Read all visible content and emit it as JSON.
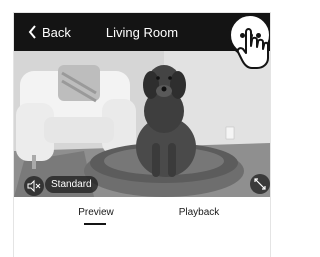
{
  "header": {
    "back_label": "Back",
    "title": "Living Room",
    "back_icon": "chevron-left-icon",
    "more_icon": "more-horizontal-icon"
  },
  "video": {
    "mute_icon": "speaker-muted-icon",
    "quality_label": "Standard",
    "fullscreen_icon": "fullscreen-icon"
  },
  "tabs": {
    "items": [
      {
        "label": "Preview",
        "selected": true
      },
      {
        "label": "Playback",
        "selected": false
      }
    ]
  },
  "colors": {
    "header_bg": "#141414",
    "accent": "#141414"
  }
}
